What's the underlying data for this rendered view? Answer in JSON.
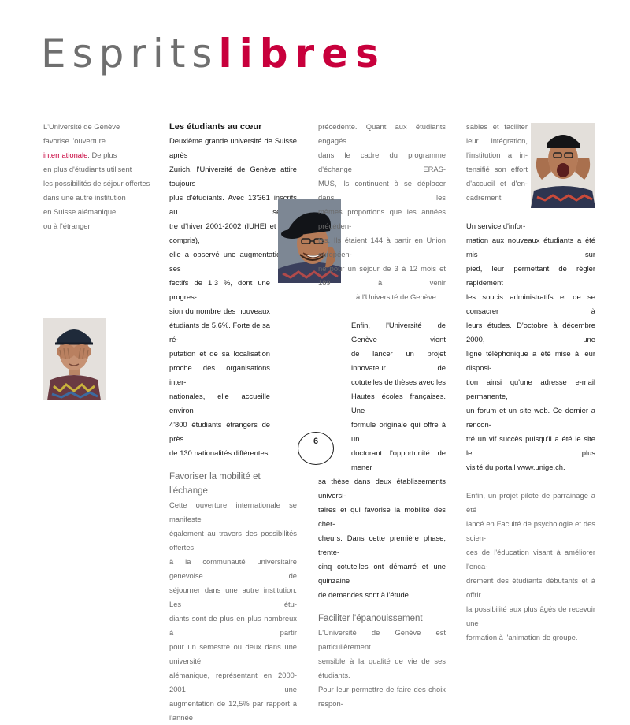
{
  "title": {
    "part1": "Esprits",
    "part2": "libres"
  },
  "sidebar": {
    "line1": "L'Université de Genève",
    "line2": "favorise l'ouverture",
    "highlight": "internationale",
    "line3_rest": ". De plus",
    "line4": "en plus d'étudiants utilisent",
    "line5": "les possibilités de séjour offertes",
    "line6": "dans une autre institution",
    "line7": "en Suisse alémanique",
    "line8": "ou à l'étranger."
  },
  "col2": {
    "heading": "Les étudiants au cœur",
    "lines": [
      "Deuxième grande université de Suisse après",
      "Zurich, l'Université de Genève attire toujours",
      "plus d'étudiants. Avec 13'361 inscrits au semes-",
      "tre d'hiver 2001-2002 (IUHEI et IUED compris),",
      "elle a observé une augmentation de ses ef-",
      "fectifs de 1,3 %, dont une progres-",
      "sion du nombre des nouveaux",
      "étudiants de 5,6%. Forte de sa ré-",
      "putation et de sa localisation",
      "proche des organisations inter-",
      "nationales, elle accueille environ",
      "4'800 étudiants étrangers de près",
      "de 130 nationalités différentes."
    ],
    "heading2": "Favoriser la mobilité et l'échange",
    "lines2": [
      "Cette ouverture internationale se manifeste",
      "également au travers des possibilités offertes",
      "à la communauté universitaire genevoise de",
      "séjourner dans une autre institution. Les étu-",
      "diants sont de plus en plus nombreux à partir",
      "pour un semestre ou deux dans une université",
      "alémanique, représentant en 2000-2001 une",
      "augmentation de 12,5% par rapport à l'année"
    ]
  },
  "col3": {
    "lines": [
      "précédente. Quant aux étudiants engagés",
      "dans le cadre du programme d'échange ERAS-",
      "MUS, ils continuent à se déplacer dans les",
      "mêmes proportions que les années précéden-",
      "tes. Ils étaient 144 à partir en Union européen-",
      "ne pour un séjour de 3 à 12 mois et 189 à venir",
      "à l'Université de Genève."
    ],
    "lines_b": [
      "Enfin, l'Université de Genève vient",
      "de lancer un projet innovateur de",
      "cotutelles de thèses avec les",
      "Hautes écoles françaises. Une",
      "formule originale qui offre à un",
      "doctorant l'opportunité de mener",
      "sa thèse dans deux établissements universi-",
      "taires et qui favorise la mobilité des cher-",
      "cheurs. Dans cette première phase, trente-",
      "cinq cotutelles ont démarré et une quinzaine",
      "de demandes sont à l'étude."
    ],
    "heading": "Faciliter l'épanouissement",
    "lines_c": [
      "L'Université de Genève est particulièrement",
      "sensible à la qualité de vie de ses étudiants.",
      "Pour leur permettre de faire des choix respon-"
    ]
  },
  "col4": {
    "lines_a": [
      "sables et faciliter",
      "leur intégration,",
      "l'institution a in-",
      "tensifié son effort",
      "d'accueil et d'en-",
      "cadrement."
    ],
    "lines_b": [
      "Un service d'infor-",
      "mation aux nouveaux étudiants a été mis sur",
      "pied, leur permettant de régler rapidement",
      "les soucis administratifs et de se consacrer à",
      "leurs études. D'octobre à décembre 2000, une",
      "ligne téléphonique a été mise à leur disposi-",
      "tion ainsi qu'une adresse e-mail permanente,",
      "un forum et un site web. Ce dernier a rencon-",
      "tré un vif succès puisqu'il a été le site le plus",
      "visité du portail www.unige.ch."
    ],
    "lines_c": [
      "Enfin, un projet pilote de parrainage a été",
      "lancé en Faculté de psychologie et des scien-",
      "ces de l'éducation visant à améliorer l'enca-",
      "drement des étudiants débutants et à offrir",
      "la possibilité aux plus âgés de recevoir une",
      "formation à l'animation de groupe."
    ]
  },
  "page_number": "6",
  "colors": {
    "accent": "#c8003c",
    "title_grey": "#6f6f6f"
  }
}
